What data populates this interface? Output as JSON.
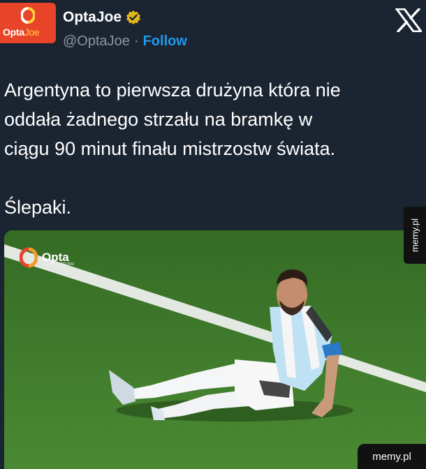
{
  "header": {
    "avatar_text_a": "Opta",
    "avatar_text_b": "Joe",
    "display_name": "OptaJoe",
    "handle": "@OptaJoe",
    "separator": "·",
    "follow_label": "Follow"
  },
  "tweet": {
    "line1": "Argentyna to pierwsza drużyna która nie\noddała żadnego strzału na bramkę w\nciągu 90 minut finału mistrzostw świata.",
    "line2": "Ślepaki."
  },
  "media": {
    "badge_word": "Opta",
    "badge_sub": "STATS PERFORM"
  },
  "watermark": {
    "side": "memy.pl",
    "bottom": "memy.pl"
  },
  "colors": {
    "background": "#1b2431",
    "accent": "#1d9bf0",
    "avatar": "#e8442a",
    "pitch": "#3f7a2c"
  },
  "icons": [
    "verified-icon",
    "x-logo-icon",
    "opta-logo-icon"
  ]
}
